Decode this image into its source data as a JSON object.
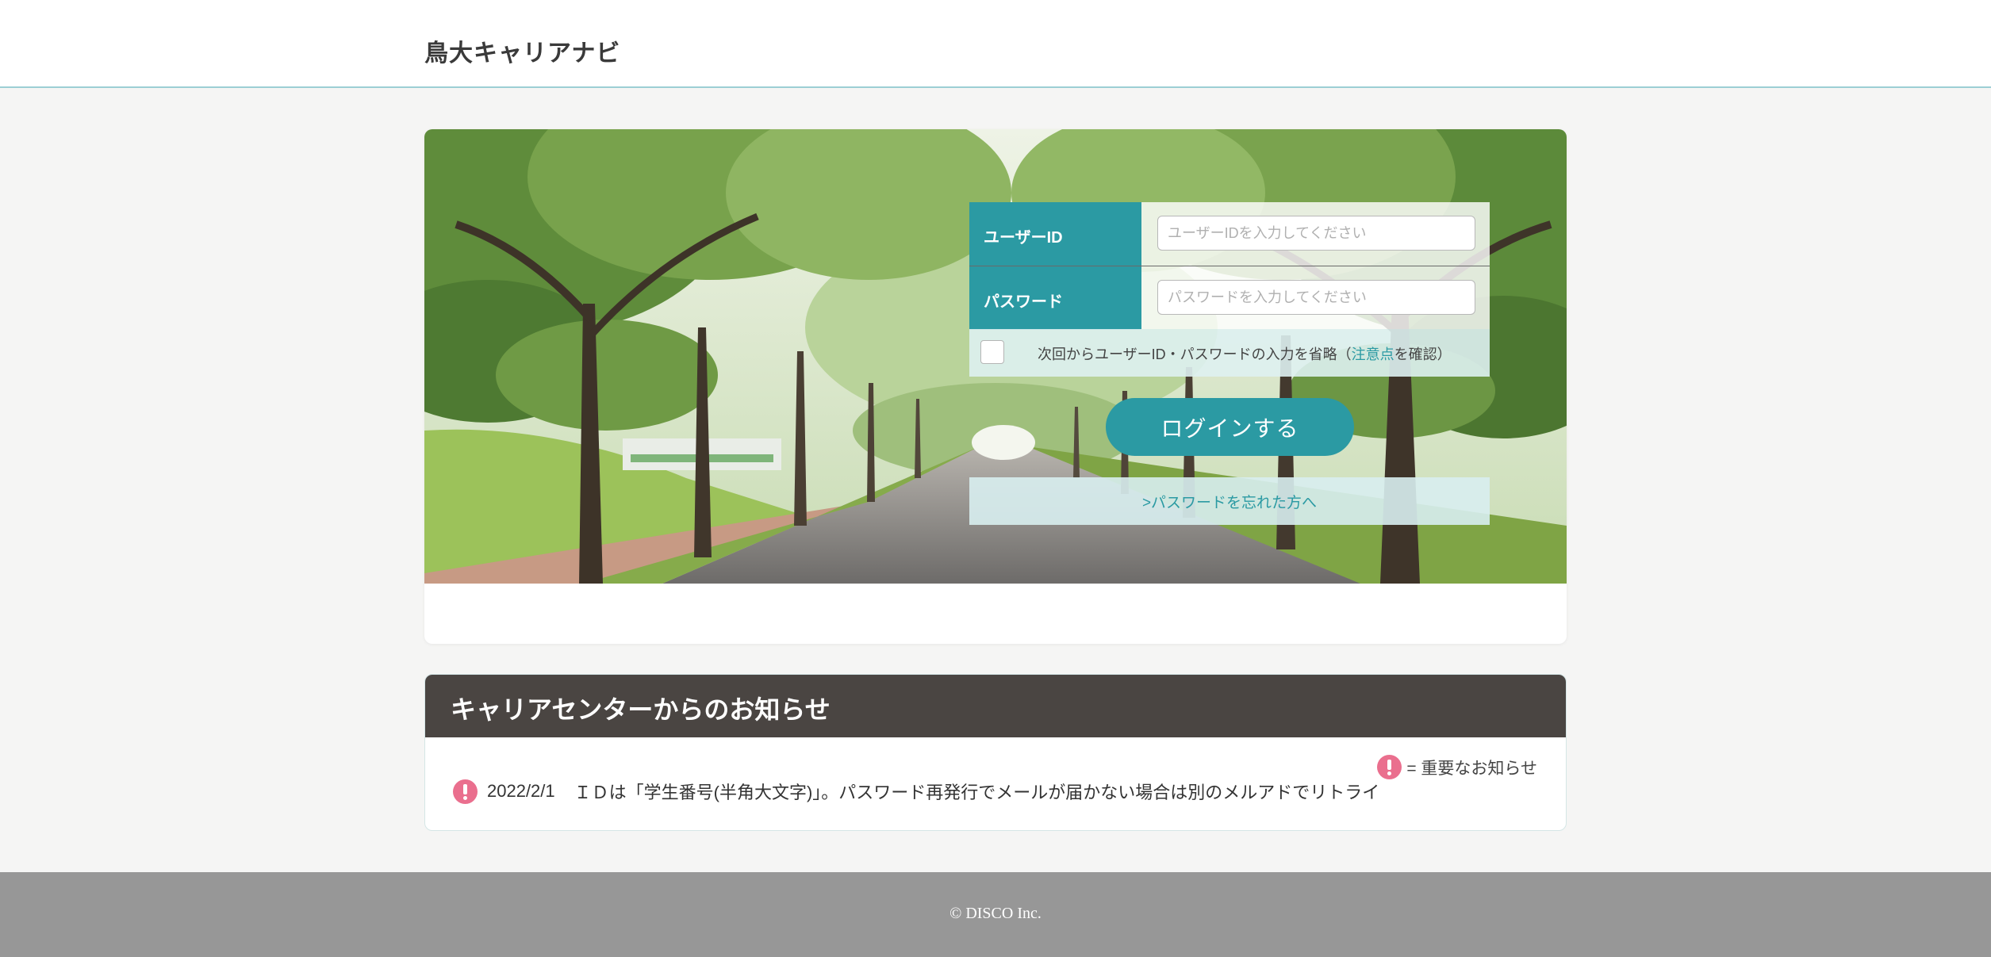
{
  "header": {
    "site_title": "鳥大キャリアナビ"
  },
  "login": {
    "user_id_label": "ユーザーID",
    "user_id_placeholder": "ユーザーIDを入力してください",
    "user_id_value": "",
    "password_label": "パスワード",
    "password_placeholder": "パスワードを入力してください",
    "password_value": "",
    "remember_checked": false,
    "remember_text_before": "次回からユーザーID・パスワードの入力を省略（",
    "remember_link": "注意点",
    "remember_text_after": "を確認）",
    "login_button": "ログインする",
    "forgot_password_link": ">パスワードを忘れた方へ"
  },
  "notices": {
    "title": "キャリアセンターからのお知らせ",
    "legend_text": "= 重要なお知らせ",
    "items": [
      {
        "date": "2022/2/1",
        "text": "ＩＤは「学生番号(半角大文字)」。パスワード再発行でメールが届かない場合は別のメルアドでリトライ",
        "important": true
      }
    ]
  },
  "footer": {
    "copyright": "© DISCO Inc."
  },
  "colors": {
    "accent": "#2b9aa3",
    "notice_header": "#4a4542",
    "important": "#ea6f8e",
    "footer": "#979797",
    "header_border": "#9ccfd4"
  }
}
